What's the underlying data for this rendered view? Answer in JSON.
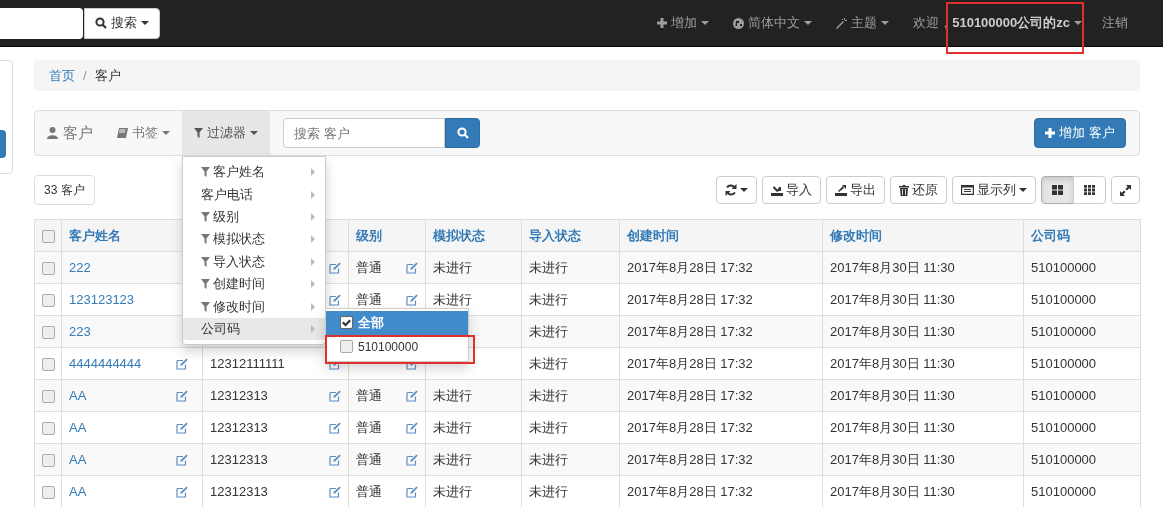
{
  "nav": {
    "search_button": "搜索",
    "items": [
      {
        "label": "增加",
        "highlighted": false
      },
      {
        "label": "简体中文",
        "highlighted": false
      },
      {
        "label": "主题",
        "highlighted": false
      },
      {
        "label": "欢迎，**510100000公司的zc**",
        "highlighted": true
      }
    ],
    "logout": "注销"
  },
  "breadcrumb": {
    "separator": "/",
    "items": [
      {
        "label": "首页",
        "current": false
      },
      {
        "label": "客户",
        "current": true
      }
    ]
  },
  "toolbar": {
    "title": "客户",
    "bookmarks": "书签",
    "filter": {
      "label": "过滤器",
      "expanded": true
    },
    "search": {
      "placeholder": "搜索 客户"
    },
    "add_button": "增加 客户"
  },
  "filter_menu": [
    {
      "label": "客户姓名",
      "filtered": true,
      "hovered": false
    },
    {
      "label": "客户电话",
      "filtered": false,
      "hovered": false
    },
    {
      "label": "级别",
      "filtered": true,
      "hovered": false
    },
    {
      "label": "模拟状态",
      "filtered": true,
      "hovered": false
    },
    {
      "label": "导入状态",
      "filtered": true,
      "hovered": false
    },
    {
      "label": "创建时间",
      "filtered": true,
      "hovered": false
    },
    {
      "label": "修改时间",
      "filtered": true,
      "hovered": false
    },
    {
      "label": "公司码",
      "filtered": false,
      "hovered": true,
      "submenu": [
        {
          "label": "全部",
          "checked": true,
          "selected": true,
          "highlighted": false
        },
        {
          "label": "510100000",
          "checked": false,
          "selected": false,
          "highlighted": true
        }
      ]
    }
  ],
  "count": "33 客户",
  "table_actions": [
    {
      "kind": "refresh"
    },
    {
      "kind": "import",
      "label": "导入"
    },
    {
      "kind": "export",
      "label": "导出"
    },
    {
      "kind": "restore",
      "label": "还原"
    },
    {
      "kind": "columns",
      "label": "显示列"
    }
  ],
  "view_toggle": [
    {
      "kind": "cards",
      "selected": true
    },
    {
      "kind": "grid",
      "selected": false
    }
  ],
  "table": {
    "all_checked": false,
    "columns": [
      {
        "label": "客户姓名",
        "editable": true
      },
      {
        "editable": true
      },
      {
        "label": "级别",
        "editable": true
      },
      {
        "label": "模拟状态"
      },
      {
        "label": "导入状态"
      },
      {
        "label": "创建时间"
      },
      {
        "label": "修改时间"
      },
      {
        "label": "公司码"
      }
    ],
    "rows": [
      {
        "checked": false,
        "cells": [
          "222",
          null,
          "普通",
          "未进行",
          "未进行",
          "2017年8月28日 17:32",
          "2017年8月30日 11:30",
          "510100000"
        ]
      },
      {
        "checked": false,
        "cells": [
          "123123123",
          null,
          "普通",
          "未进行",
          "未进行",
          "2017年8月28日 17:32",
          "2017年8月30日 11:30",
          "510100000"
        ]
      },
      {
        "checked": false,
        "cells": [
          "223",
          null,
          null,
          null,
          "未进行",
          "2017年8月28日 17:32",
          "2017年8月30日 11:30",
          "510100000"
        ]
      },
      {
        "checked": false,
        "cells": [
          "4444444444",
          "12312111111",
          null,
          null,
          "未进行",
          "2017年8月28日 17:32",
          "2017年8月30日 11:30",
          "510100000"
        ]
      },
      {
        "checked": false,
        "cells": [
          "AA",
          "12312313",
          "普通",
          "未进行",
          "未进行",
          "2017年8月28日 17:32",
          "2017年8月30日 11:30",
          "510100000"
        ]
      },
      {
        "checked": false,
        "cells": [
          "AA",
          "12312313",
          "普通",
          "未进行",
          "未进行",
          "2017年8月28日 17:32",
          "2017年8月30日 11:30",
          "510100000"
        ]
      },
      {
        "checked": false,
        "cells": [
          "AA",
          "12312313",
          "普通",
          "未进行",
          "未进行",
          "2017年8月28日 17:32",
          "2017年8月30日 11:30",
          "510100000"
        ]
      },
      {
        "checked": false,
        "cells": [
          "AA",
          "12312313",
          "普通",
          "未进行",
          "未进行",
          "2017年8月28日 17:32",
          "2017年8月30日 11:30",
          "510100000"
        ]
      }
    ]
  }
}
